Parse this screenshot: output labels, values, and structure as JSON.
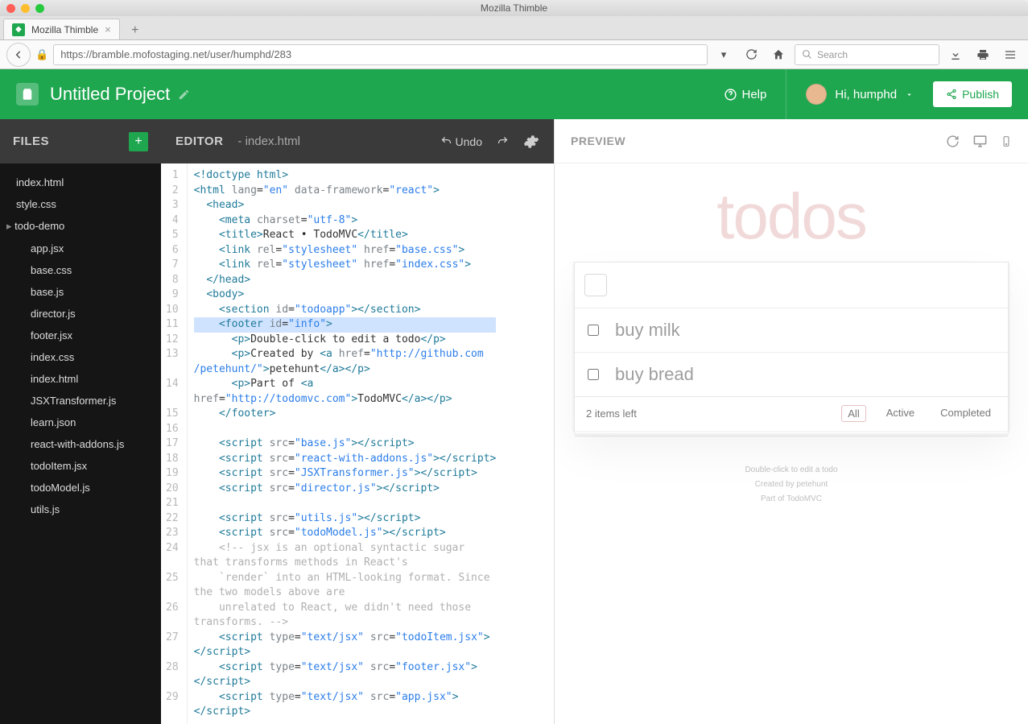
{
  "window": {
    "title": "Mozilla Thimble"
  },
  "browser": {
    "tab_title": "Mozilla Thimble",
    "url": "https://bramble.mofostaging.net/user/humphd/283",
    "search_placeholder": "Search"
  },
  "header": {
    "project_title": "Untitled Project",
    "help_label": "Help",
    "greeting": "Hi, humphd",
    "publish_label": "Publish"
  },
  "files": {
    "title": "FILES",
    "items": [
      {
        "name": "index.html",
        "type": "file"
      },
      {
        "name": "style.css",
        "type": "file"
      },
      {
        "name": "todo-demo",
        "type": "folder"
      },
      {
        "name": "app.jsx",
        "type": "child"
      },
      {
        "name": "base.css",
        "type": "child"
      },
      {
        "name": "base.js",
        "type": "child"
      },
      {
        "name": "director.js",
        "type": "child"
      },
      {
        "name": "footer.jsx",
        "type": "child"
      },
      {
        "name": "index.css",
        "type": "child"
      },
      {
        "name": "index.html",
        "type": "child"
      },
      {
        "name": "JSXTransformer.js",
        "type": "child"
      },
      {
        "name": "learn.json",
        "type": "child"
      },
      {
        "name": "react-with-addons.js",
        "type": "child"
      },
      {
        "name": "todoItem.jsx",
        "type": "child"
      },
      {
        "name": "todoModel.js",
        "type": "child"
      },
      {
        "name": "utils.js",
        "type": "child"
      }
    ]
  },
  "editor": {
    "title": "EDITOR",
    "filename": "index.html",
    "undo_label": "Undo",
    "lines": [
      {
        "n": 1,
        "html": "<span class='t-tag'>&lt;!doctype html&gt;</span>"
      },
      {
        "n": 2,
        "html": "<span class='t-tag'>&lt;html</span> <span class='t-attr'>lang</span>=<span class='t-str'>\"en\"</span> <span class='t-attr'>data-framework</span>=<span class='t-str'>\"react\"</span><span class='t-tag'>&gt;</span>"
      },
      {
        "n": 3,
        "html": "  <span class='t-tag'>&lt;head&gt;</span>"
      },
      {
        "n": 4,
        "html": "    <span class='t-tag'>&lt;meta</span> <span class='t-attr'>charset</span>=<span class='t-str'>\"utf-8\"</span><span class='t-tag'>&gt;</span>"
      },
      {
        "n": 5,
        "html": "    <span class='t-tag'>&lt;title&gt;</span>React • TodoMVC<span class='t-tag'>&lt;/title&gt;</span>"
      },
      {
        "n": 6,
        "html": "    <span class='t-tag'>&lt;link</span> <span class='t-attr'>rel</span>=<span class='t-str'>\"stylesheet\"</span> <span class='t-attr'>href</span>=<span class='t-str'>\"base.css\"</span><span class='t-tag'>&gt;</span>"
      },
      {
        "n": 7,
        "html": "    <span class='t-tag'>&lt;link</span> <span class='t-attr'>rel</span>=<span class='t-str'>\"stylesheet\"</span> <span class='t-attr'>href</span>=<span class='t-str'>\"index.css\"</span><span class='t-tag'>&gt;</span>"
      },
      {
        "n": 8,
        "html": "  <span class='t-tag'>&lt;/head&gt;</span>"
      },
      {
        "n": 9,
        "html": "  <span class='t-tag'>&lt;body&gt;</span>"
      },
      {
        "n": 10,
        "html": "    <span class='t-tag'>&lt;section</span> <span class='t-attr'>id</span>=<span class='t-str'>\"todoapp\"</span><span class='t-tag'>&gt;&lt;/section&gt;</span>"
      },
      {
        "n": 11,
        "hl": true,
        "html": "    <span class='t-tag'>&lt;footer</span> <span class='t-attr'>id</span>=<span class='t-str'>\"info\"</span><span class='t-tag'>&gt;</span>"
      },
      {
        "n": 12,
        "html": "      <span class='t-tag'>&lt;p&gt;</span>Double-click to edit a todo<span class='t-tag'>&lt;/p&gt;</span>"
      },
      {
        "n": 13,
        "html": "      <span class='t-tag'>&lt;p&gt;</span>Created by <span class='t-tag'>&lt;a</span> <span class='t-attr'>href</span>=<span class='t-str'>\"http://github.com</span>"
      },
      {
        "n": "",
        "html": "<span class='t-str'>/petehunt/\"</span><span class='t-tag'>&gt;</span>petehunt<span class='t-tag'>&lt;/a&gt;&lt;/p&gt;</span>"
      },
      {
        "n": 14,
        "html": "      <span class='t-tag'>&lt;p&gt;</span>Part of <span class='t-tag'>&lt;a</span>"
      },
      {
        "n": "",
        "html": "<span class='t-attr'>href</span>=<span class='t-str'>\"http://todomvc.com\"</span><span class='t-tag'>&gt;</span>TodoMVC<span class='t-tag'>&lt;/a&gt;&lt;/p&gt;</span>"
      },
      {
        "n": 15,
        "html": "    <span class='t-tag'>&lt;/footer&gt;</span>"
      },
      {
        "n": 16,
        "html": ""
      },
      {
        "n": 17,
        "html": "    <span class='t-tag'>&lt;script</span> <span class='t-attr'>src</span>=<span class='t-str'>\"base.js\"</span><span class='t-tag'>&gt;&lt;/script&gt;</span>"
      },
      {
        "n": 18,
        "html": "    <span class='t-tag'>&lt;script</span> <span class='t-attr'>src</span>=<span class='t-str'>\"react-with-addons.js\"</span><span class='t-tag'>&gt;&lt;/script&gt;</span>"
      },
      {
        "n": 19,
        "html": "    <span class='t-tag'>&lt;script</span> <span class='t-attr'>src</span>=<span class='t-str'>\"JSXTransformer.js\"</span><span class='t-tag'>&gt;&lt;/script&gt;</span>"
      },
      {
        "n": 20,
        "html": "    <span class='t-tag'>&lt;script</span> <span class='t-attr'>src</span>=<span class='t-str'>\"director.js\"</span><span class='t-tag'>&gt;&lt;/script&gt;</span>"
      },
      {
        "n": 21,
        "html": ""
      },
      {
        "n": 22,
        "html": "    <span class='t-tag'>&lt;script</span> <span class='t-attr'>src</span>=<span class='t-str'>\"utils.js\"</span><span class='t-tag'>&gt;&lt;/script&gt;</span>"
      },
      {
        "n": 23,
        "html": "    <span class='t-tag'>&lt;script</span> <span class='t-attr'>src</span>=<span class='t-str'>\"todoModel.js\"</span><span class='t-tag'>&gt;&lt;/script&gt;</span>"
      },
      {
        "n": 24,
        "html": "    <span class='t-cmt'>&lt;!-- jsx is an optional syntactic sugar</span>"
      },
      {
        "n": "",
        "html": "<span class='t-cmt'>that transforms methods in React's</span>"
      },
      {
        "n": 25,
        "html": "    <span class='t-cmt'>`render` into an HTML-looking format. Since</span>"
      },
      {
        "n": "",
        "html": "<span class='t-cmt'>the two models above are</span>"
      },
      {
        "n": 26,
        "html": "    <span class='t-cmt'>unrelated to React, we didn't need those</span>"
      },
      {
        "n": "",
        "html": "<span class='t-cmt'>transforms. --&gt;</span>"
      },
      {
        "n": 27,
        "html": "    <span class='t-tag'>&lt;script</span> <span class='t-attr'>type</span>=<span class='t-str'>\"text/jsx\"</span> <span class='t-attr'>src</span>=<span class='t-str'>\"todoItem.jsx\"</span><span class='t-tag'>&gt;</span>"
      },
      {
        "n": "",
        "html": "<span class='t-tag'>&lt;/script&gt;</span>"
      },
      {
        "n": 28,
        "html": "    <span class='t-tag'>&lt;script</span> <span class='t-attr'>type</span>=<span class='t-str'>\"text/jsx\"</span> <span class='t-attr'>src</span>=<span class='t-str'>\"footer.jsx\"</span><span class='t-tag'>&gt;</span>"
      },
      {
        "n": "",
        "html": "<span class='t-tag'>&lt;/script&gt;</span>"
      },
      {
        "n": 29,
        "html": "    <span class='t-tag'>&lt;script</span> <span class='t-attr'>type</span>=<span class='t-str'>\"text/jsx\"</span> <span class='t-attr'>src</span>=<span class='t-str'>\"app.jsx\"</span><span class='t-tag'>&gt;</span>"
      },
      {
        "n": "",
        "html": "<span class='t-tag'>&lt;/script&gt;</span>"
      }
    ]
  },
  "preview": {
    "title": "PREVIEW",
    "heading": "todos",
    "todos": [
      "buy milk",
      "buy bread"
    ],
    "count_text": "2 items left",
    "filters": [
      "All",
      "Active",
      "Completed"
    ],
    "info_line1": "Double-click to edit a todo",
    "info_line2_pre": "Created by ",
    "info_line2_link": "petehunt",
    "info_line3_pre": "Part of ",
    "info_line3_link": "TodoMVC"
  }
}
